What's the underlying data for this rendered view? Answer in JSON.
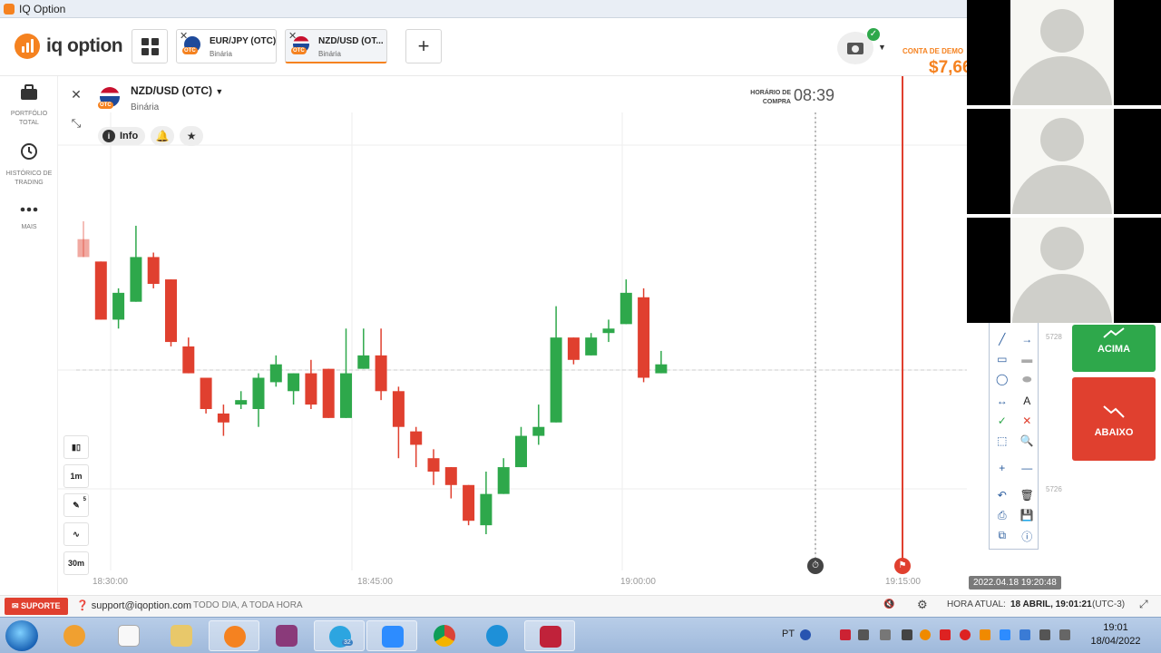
{
  "window": {
    "title": "IQ Option"
  },
  "header": {
    "brand": "iq option",
    "tabs": [
      {
        "name": "EUR/JPY (OTC)",
        "type": "Binária",
        "badge": "OTC"
      },
      {
        "name": "NZD/USD (OT...",
        "type": "Binária",
        "badge": "OTC"
      }
    ],
    "account_label": "CONTA DE DEMO",
    "balance": "$7,66"
  },
  "sidebar": {
    "items": [
      {
        "label": "PORTFÓLIO TOTAL",
        "icon": "briefcase-icon"
      },
      {
        "label": "HISTÓRICO DE TRADING",
        "icon": "history-icon"
      },
      {
        "label": "MAIS",
        "icon": "more-dots-icon"
      }
    ]
  },
  "asset": {
    "name": "NZD/USD (OTC)",
    "type": "Binária",
    "badge": "OTC",
    "info_label": "Info",
    "purchase_time_label": "HORÁRIO DE COMPRA",
    "purchase_time": "08:39"
  },
  "chart_tools": {
    "timeframe": "1m",
    "period": "30m",
    "draw_badge": "5"
  },
  "chart_data": {
    "type": "candlestick",
    "x_ticks": [
      "18:30:00",
      "18:45:00",
      "19:00:00",
      "19:15:00"
    ],
    "price_labels": [
      "5728",
      "5726"
    ],
    "timestamp_badge": "2022.04.18 19:20:48",
    "candles": [
      {
        "o": 0.5763,
        "c": 0.5759,
        "h": 0.5767,
        "l": 0.5759
      },
      {
        "o": 0.5758,
        "c": 0.5745,
        "h": 0.5758,
        "l": 0.5745
      },
      {
        "o": 0.5745,
        "c": 0.5751,
        "h": 0.5752,
        "l": 0.5743
      },
      {
        "o": 0.5749,
        "c": 0.5759,
        "h": 0.5766,
        "l": 0.5749
      },
      {
        "o": 0.5759,
        "c": 0.5753,
        "h": 0.576,
        "l": 0.5752
      },
      {
        "o": 0.5754,
        "c": 0.574,
        "h": 0.5754,
        "l": 0.5739
      },
      {
        "o": 0.5739,
        "c": 0.5733,
        "h": 0.5741,
        "l": 0.5733
      },
      {
        "o": 0.5732,
        "c": 0.5725,
        "h": 0.5732,
        "l": 0.5724
      },
      {
        "o": 0.5724,
        "c": 0.5722,
        "h": 0.5726,
        "l": 0.5719
      },
      {
        "o": 0.5726,
        "c": 0.5727,
        "h": 0.5729,
        "l": 0.5725
      },
      {
        "o": 0.5725,
        "c": 0.5732,
        "h": 0.5733,
        "l": 0.5721
      },
      {
        "o": 0.5731,
        "c": 0.5735,
        "h": 0.5737,
        "l": 0.573
      },
      {
        "o": 0.5729,
        "c": 0.5733,
        "h": 0.5733,
        "l": 0.5726
      },
      {
        "o": 0.5733,
        "c": 0.5726,
        "h": 0.5736,
        "l": 0.5725
      },
      {
        "o": 0.5734,
        "c": 0.5723,
        "h": 0.5734,
        "l": 0.5723
      },
      {
        "o": 0.5723,
        "c": 0.5733,
        "h": 0.5743,
        "l": 0.5723
      },
      {
        "o": 0.5734,
        "c": 0.5737,
        "h": 0.5743,
        "l": 0.5734
      },
      {
        "o": 0.5737,
        "c": 0.5729,
        "h": 0.5743,
        "l": 0.5727
      },
      {
        "o": 0.5729,
        "c": 0.5721,
        "h": 0.573,
        "l": 0.5714
      },
      {
        "o": 0.572,
        "c": 0.5717,
        "h": 0.5721,
        "l": 0.5712
      },
      {
        "o": 0.5714,
        "c": 0.5711,
        "h": 0.5716,
        "l": 0.5708
      },
      {
        "o": 0.5712,
        "c": 0.5708,
        "h": 0.5712,
        "l": 0.5705
      },
      {
        "o": 0.5708,
        "c": 0.57,
        "h": 0.5708,
        "l": 0.5699
      },
      {
        "o": 0.5699,
        "c": 0.5706,
        "h": 0.5711,
        "l": 0.5697
      },
      {
        "o": 0.5706,
        "c": 0.5712,
        "h": 0.5714,
        "l": 0.5706
      },
      {
        "o": 0.5712,
        "c": 0.5719,
        "h": 0.5721,
        "l": 0.5712
      },
      {
        "o": 0.5719,
        "c": 0.5721,
        "h": 0.5726,
        "l": 0.5717
      },
      {
        "o": 0.5722,
        "c": 0.5741,
        "h": 0.5748,
        "l": 0.5722
      },
      {
        "o": 0.5741,
        "c": 0.5736,
        "h": 0.5741,
        "l": 0.5735
      },
      {
        "o": 0.5737,
        "c": 0.5741,
        "h": 0.5742,
        "l": 0.5737
      },
      {
        "o": 0.5742,
        "c": 0.5743,
        "h": 0.5745,
        "l": 0.574
      },
      {
        "o": 0.5744,
        "c": 0.5751,
        "h": 0.5754,
        "l": 0.5744
      },
      {
        "o": 0.575,
        "c": 0.5732,
        "h": 0.5752,
        "l": 0.5731
      },
      {
        "o": 0.5733,
        "c": 0.5735,
        "h": 0.5738,
        "l": 0.5733
      }
    ],
    "colors": {
      "up": "#2ea84b",
      "down": "#e0402f"
    }
  },
  "trade": {
    "up_label": "ACIMA",
    "down_label": "ABAIXO",
    "up_color": "#2ea84b",
    "down_color": "#e0402f"
  },
  "footer": {
    "support_label": "SUPORTE",
    "support_email": "support@iqoption.com",
    "support_hours": "TODO DIA, A TODA HORA",
    "current_time_label": "HORA ATUAL:",
    "current_time": "18 ABRIL, 19:01:21",
    "timezone": "(UTC-3)"
  },
  "taskbar": {
    "language": "PT",
    "clock_time": "19:01",
    "clock_date": "18/04/2022",
    "telegram_badge": "32"
  }
}
